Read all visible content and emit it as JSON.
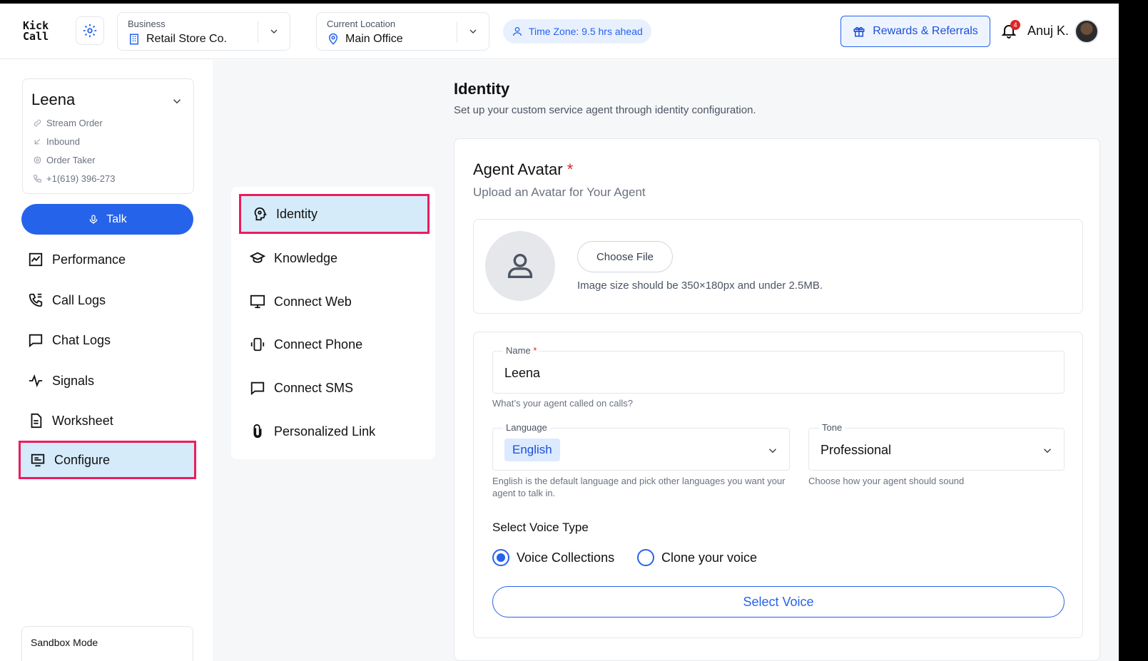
{
  "app": {
    "logo_line1": "Kick",
    "logo_line2": "Call"
  },
  "header": {
    "business": {
      "label": "Business",
      "value": "Retail Store Co."
    },
    "location": {
      "label": "Current Location",
      "value": "Main Office"
    },
    "timezone": "Time Zone: 9.5 hrs ahead",
    "rewards_label": "Rewards & Referrals",
    "notification_count": "4",
    "user_name": "Anuj K."
  },
  "agent": {
    "name": "Leena",
    "meta": [
      "Stream Order",
      "Inbound",
      "Order Taker",
      "+1(619) 396-273"
    ]
  },
  "sidebar": {
    "talk_label": "Talk",
    "items": [
      {
        "label": "Performance",
        "icon": "chart-icon"
      },
      {
        "label": "Call Logs",
        "icon": "phone-log-icon"
      },
      {
        "label": "Chat Logs",
        "icon": "chat-icon"
      },
      {
        "label": "Signals",
        "icon": "pulse-icon"
      },
      {
        "label": "Worksheet",
        "icon": "document-icon"
      },
      {
        "label": "Configure",
        "icon": "configure-icon",
        "active": true
      }
    ],
    "sandbox_label": "Sandbox Mode"
  },
  "submenu": {
    "items": [
      {
        "label": "Identity",
        "icon": "identity-icon",
        "active": true
      },
      {
        "label": "Knowledge",
        "icon": "graduation-cap-icon"
      },
      {
        "label": "Connect Web",
        "icon": "monitor-icon"
      },
      {
        "label": "Connect Phone",
        "icon": "vibrate-phone-icon"
      },
      {
        "label": "Connect SMS",
        "icon": "message-icon"
      },
      {
        "label": "Personalized Link",
        "icon": "paperclip-icon"
      }
    ]
  },
  "main": {
    "title": "Identity",
    "subtitle": "Set up your custom service agent through identity configuration.",
    "avatar_section": {
      "title": "Agent Avatar",
      "required_mark": "*",
      "subtitle": "Upload an Avatar for Your Agent",
      "choose_file": "Choose File",
      "hint": "Image size should be 350×180px and under 2.5MB."
    },
    "name_field": {
      "label": "Name",
      "required_mark": "*",
      "value": "Leena",
      "helper": "What’s your agent called on calls?"
    },
    "language_field": {
      "label": "Language",
      "value": "English",
      "helper": "English is the default language and pick other languages you want your agent to talk in."
    },
    "tone_field": {
      "label": "Tone",
      "value": "Professional",
      "helper": "Choose how your agent should sound"
    },
    "voice": {
      "title": "Select Voice Type",
      "options": [
        {
          "label": "Voice Collections",
          "selected": true
        },
        {
          "label": "Clone your voice",
          "selected": false
        }
      ],
      "select_button": "Select Voice"
    }
  },
  "colors": {
    "accent": "#2563eb",
    "highlight_border": "#ec1c5c",
    "active_bg": "#d6ebfa"
  }
}
